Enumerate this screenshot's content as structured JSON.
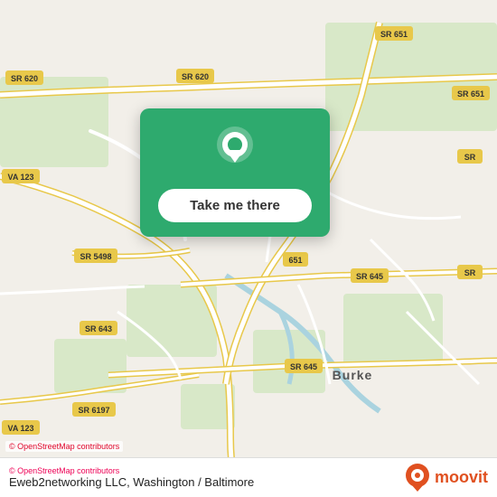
{
  "map": {
    "bg_color": "#f2efe9",
    "road_color": "#ffffff",
    "road_stroke": "#ccc",
    "yellow_road": "#f5d76e",
    "water_color": "#aad3df"
  },
  "card": {
    "bg_color": "#2eaa6e",
    "button_label": "Take me there",
    "icon": "location-pin"
  },
  "bottom_bar": {
    "copyright": "© OpenStreetMap contributors",
    "location_label": "Eweb2networking LLC, Washington / Baltimore",
    "moovit_label": "moovit"
  },
  "road_labels": [
    {
      "id": "sr620_top",
      "text": "SR 620"
    },
    {
      "id": "sr651_top",
      "text": "SR 651"
    },
    {
      "id": "sr651_right",
      "text": "SR 651"
    },
    {
      "id": "va123_left",
      "text": "VA 123"
    },
    {
      "id": "sr645_mid",
      "text": "SR 645"
    },
    {
      "id": "sr5498",
      "text": "SR 5498"
    },
    {
      "id": "sr651_mid",
      "text": "651"
    },
    {
      "id": "sr643",
      "text": "SR 643"
    },
    {
      "id": "sr6197",
      "text": "SR 6197"
    },
    {
      "id": "sr645_bot",
      "text": "SR 645"
    },
    {
      "id": "va123_bot",
      "text": "VA 123"
    },
    {
      "id": "sr_right",
      "text": "SR"
    },
    {
      "id": "sr_right2",
      "text": "SR"
    },
    {
      "id": "burke",
      "text": "Burke"
    }
  ],
  "osm_credit": "© OpenStreetMap contributors"
}
